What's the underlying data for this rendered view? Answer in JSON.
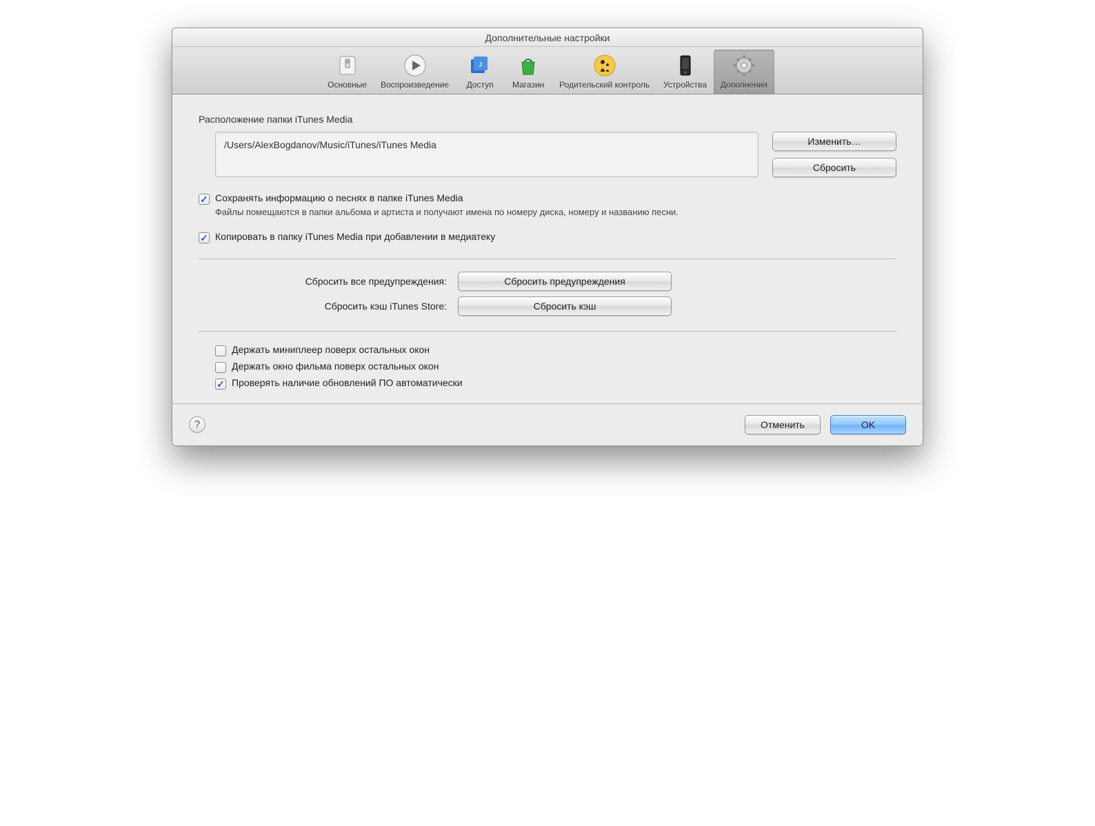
{
  "window": {
    "title": "Дополнительные настройки"
  },
  "toolbar": {
    "items": [
      {
        "label": "Основные"
      },
      {
        "label": "Воспроизведение"
      },
      {
        "label": "Доступ"
      },
      {
        "label": "Магазин"
      },
      {
        "label": "Родительский контроль"
      },
      {
        "label": "Устройства"
      },
      {
        "label": "Дополнения"
      }
    ]
  },
  "media": {
    "section_label": "Расположение папки iTunes Media",
    "path": "/Users/AlexBogdanov/Music/iTunes/iTunes Media",
    "change_btn": "Изменить…",
    "reset_btn": "Сбросить"
  },
  "checks": {
    "keep_info": "Сохранять информацию о песнях в папке iTunes Media",
    "keep_info_sub": "Файлы помещаются в папки альбома и артиста и получают имена по номеру диска, номеру и названию песни.",
    "copy_media": "Копировать в папку iTunes Media при добавлении в медиатеку"
  },
  "resets": {
    "warnings_label": "Сбросить все предупреждения:",
    "warnings_btn": "Сбросить предупреждения",
    "cache_label": "Сбросить кэш iTunes Store:",
    "cache_btn": "Сбросить кэш"
  },
  "extras": {
    "miniplayer": "Держать миниплеер поверх остальных окон",
    "movie_window": "Держать окно фильма поверх остальных окон",
    "check_updates": "Проверять наличие обновлений ПО автоматически"
  },
  "footer": {
    "help": "?",
    "cancel": "Отменить",
    "ok": "OK"
  }
}
